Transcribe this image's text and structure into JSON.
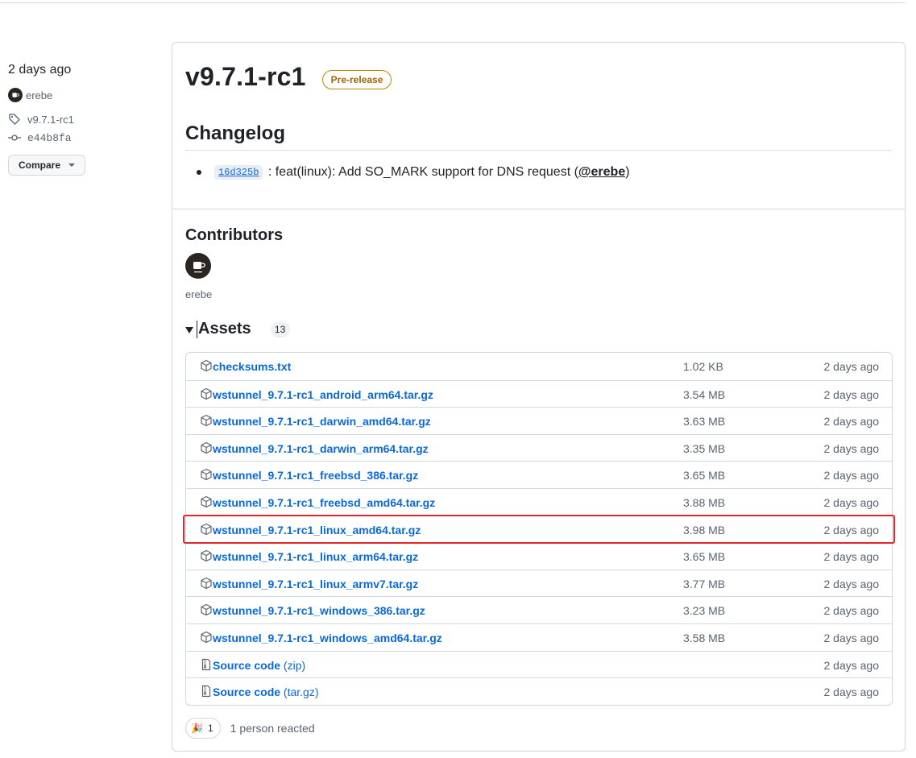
{
  "meta": {
    "time_ago": "2 days ago",
    "author": "erebe",
    "tag": "v9.7.1-rc1",
    "commit": "e44b8fa",
    "compare_label": "Compare"
  },
  "release": {
    "title": "v9.7.1-rc1",
    "badge": "Pre-release",
    "changelog_heading": "Changelog",
    "changelog_items": [
      {
        "commit": "16d325b",
        "text_before": " : feat(linux): Add SO_MARK support for DNS request (",
        "mention": "@erebe",
        "text_after": ")"
      }
    ],
    "contributors_heading": "Contributors",
    "contributors": [
      "erebe"
    ],
    "assets_heading": "Assets",
    "assets_count": "13",
    "assets": [
      {
        "name": "checksums.txt",
        "size": "1.02 KB",
        "date": "2 days ago"
      },
      {
        "name": "wstunnel_9.7.1-rc1_android_arm64.tar.gz",
        "size": "3.54 MB",
        "date": "2 days ago"
      },
      {
        "name": "wstunnel_9.7.1-rc1_darwin_amd64.tar.gz",
        "size": "3.63 MB",
        "date": "2 days ago"
      },
      {
        "name": "wstunnel_9.7.1-rc1_darwin_arm64.tar.gz",
        "size": "3.35 MB",
        "date": "2 days ago"
      },
      {
        "name": "wstunnel_9.7.1-rc1_freebsd_386.tar.gz",
        "size": "3.65 MB",
        "date": "2 days ago"
      },
      {
        "name": "wstunnel_9.7.1-rc1_freebsd_amd64.tar.gz",
        "size": "3.88 MB",
        "date": "2 days ago"
      },
      {
        "name": "wstunnel_9.7.1-rc1_linux_amd64.tar.gz",
        "size": "3.98 MB",
        "date": "2 days ago"
      },
      {
        "name": "wstunnel_9.7.1-rc1_linux_arm64.tar.gz",
        "size": "3.65 MB",
        "date": "2 days ago"
      },
      {
        "name": "wstunnel_9.7.1-rc1_linux_armv7.tar.gz",
        "size": "3.77 MB",
        "date": "2 days ago"
      },
      {
        "name": "wstunnel_9.7.1-rc1_windows_386.tar.gz",
        "size": "3.23 MB",
        "date": "2 days ago"
      },
      {
        "name": "wstunnel_9.7.1-rc1_windows_amd64.tar.gz",
        "size": "3.58 MB",
        "date": "2 days ago"
      }
    ],
    "source_assets": [
      {
        "name": "Source code",
        "ext": "(zip)",
        "date": "2 days ago"
      },
      {
        "name": "Source code",
        "ext": "(tar.gz)",
        "date": "2 days ago"
      }
    ],
    "reaction_count": "1",
    "reaction_text": "1 person reacted"
  },
  "colors": {
    "link": "#0969da",
    "prerelease_badge": "#bf8700",
    "highlight": "#e5252a"
  }
}
